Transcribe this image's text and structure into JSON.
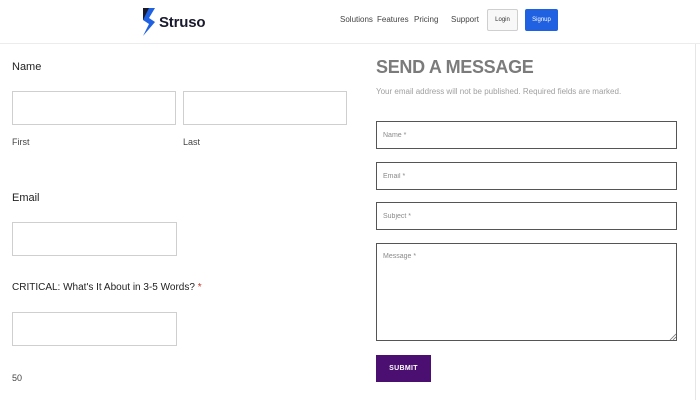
{
  "header": {
    "logo_text": "Struso",
    "brand_color": "#1f61e0",
    "nav": {
      "solutions": "Solutions",
      "features": "Features",
      "pricing": "Pricing",
      "support": "Support"
    },
    "login_label": "Login",
    "signup_label": "Signup"
  },
  "left_form": {
    "name_label": "Name",
    "first_sublabel": "First",
    "last_sublabel": "Last",
    "first_value": "",
    "last_value": "",
    "email_label": "Email",
    "email_value": "",
    "critical_label": "CRITICAL: What's It About in 3-5 Words?",
    "required_marker": "*",
    "critical_value": "",
    "char_count": "50"
  },
  "contact_form": {
    "title": "SEND A MESSAGE",
    "description": "Your email address will not be published. Required fields are marked.",
    "name_placeholder": "Name *",
    "email_placeholder": "Email *",
    "subject_placeholder": "Subject *",
    "message_placeholder": "Message *",
    "submit_label": "SUBMIT",
    "submit_color": "#4b0f72"
  }
}
